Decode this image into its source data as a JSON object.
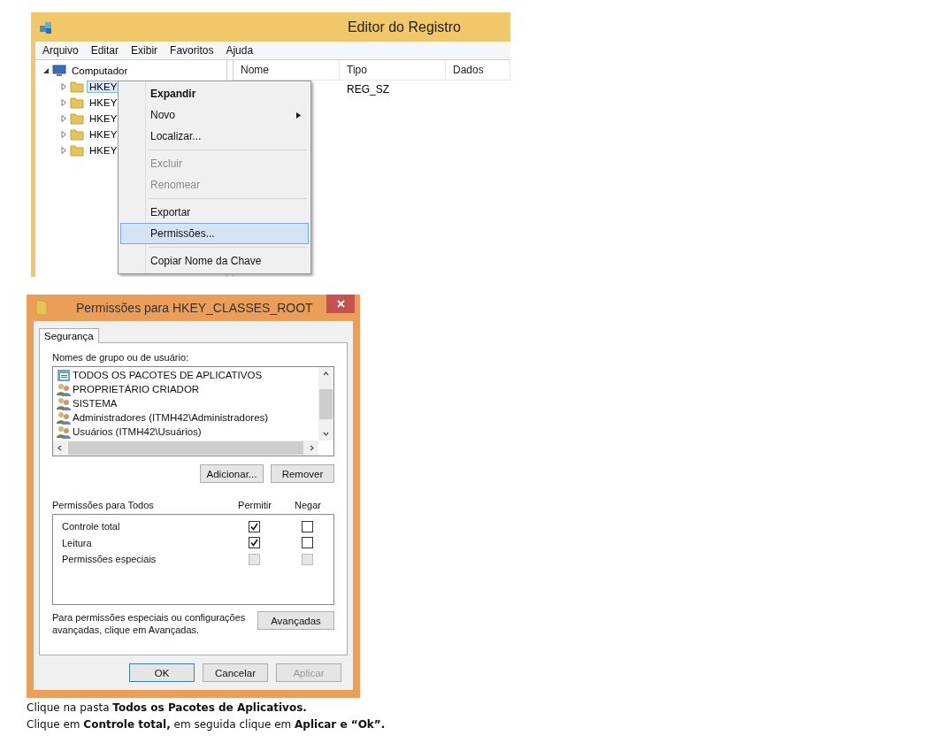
{
  "regedit": {
    "title": "Editor do Registro",
    "menu_bar": [
      "Arquivo",
      "Editar",
      "Exibir",
      "Favoritos",
      "Ajuda"
    ],
    "tree": [
      {
        "label": "Computador",
        "expanded": true,
        "selected": false,
        "children": [
          {
            "label": "HKEY",
            "expanded": false,
            "selected": true
          },
          {
            "label": "HKEY",
            "expanded": false,
            "selected": false
          },
          {
            "label": "HKEY",
            "expanded": false,
            "selected": false
          },
          {
            "label": "HKEY",
            "expanded": false,
            "selected": false
          },
          {
            "label": "HKEY",
            "expanded": false,
            "selected": false
          }
        ]
      }
    ],
    "columns": [
      "Nome",
      "Tipo",
      "Dados"
    ],
    "rows": [
      [
        "",
        "REG_SZ",
        ""
      ]
    ],
    "context_menu": [
      [
        {
          "label": "Expandir",
          "default": true,
          "disabled": false,
          "submenu": false,
          "selected": false
        },
        {
          "label": "Novo",
          "default": false,
          "disabled": false,
          "submenu": true,
          "selected": false
        },
        {
          "label": "Localizar...",
          "default": false,
          "disabled": false,
          "submenu": false,
          "selected": false
        }
      ],
      [
        {
          "label": "Excluir",
          "default": false,
          "disabled": true,
          "submenu": false,
          "selected": false
        },
        {
          "label": "Renomear",
          "default": false,
          "disabled": true,
          "submenu": false,
          "selected": false
        }
      ],
      [
        {
          "label": "Exportar",
          "default": false,
          "disabled": false,
          "submenu": false,
          "selected": false
        },
        {
          "label": "Permissões...",
          "default": false,
          "disabled": false,
          "submenu": false,
          "selected": true
        }
      ],
      [
        {
          "label": "Copiar Nome da Chave",
          "default": false,
          "disabled": false,
          "submenu": false,
          "selected": false
        }
      ]
    ]
  },
  "dialog": {
    "title": "Permissões para HKEY_CLASSES_ROOT",
    "tabs": [
      {
        "label": "Segurança",
        "selected": true
      }
    ],
    "users_label": "Nomes de grupo ou de usuário:",
    "users": [
      {
        "name": "TODOS OS PACOTES DE APLICATIVOS",
        "kind": "package"
      },
      {
        "name": "PROPRIETÁRIO CRIADOR",
        "kind": "group"
      },
      {
        "name": "SISTEMA",
        "kind": "group"
      },
      {
        "name": "Administradores (ITMH42\\Administradores)",
        "kind": "group"
      },
      {
        "name": "Usuários (ITMH42\\Usuários)",
        "kind": "group"
      }
    ],
    "user_buttons": [
      "Adicionar...",
      "Remover"
    ],
    "permissions_title": "Permissões para Todos",
    "permission_columns": [
      "Permitir",
      "Negar"
    ],
    "permissions": [
      {
        "name": "Controle total",
        "allow": {
          "checked": true,
          "disabled": false
        },
        "deny": {
          "checked": false,
          "disabled": false
        }
      },
      {
        "name": "Leitura",
        "allow": {
          "checked": true,
          "disabled": false
        },
        "deny": {
          "checked": false,
          "disabled": false
        }
      },
      {
        "name": "Permissões especiais",
        "allow": {
          "checked": false,
          "disabled": true
        },
        "deny": {
          "checked": false,
          "disabled": true
        }
      }
    ],
    "advanced_note": "Para permissões especiais ou configurações avançadas, clique em Avançadas.",
    "advanced_button": "Avançadas",
    "buttons": [
      {
        "label": "OK",
        "disabled": false,
        "default": true
      },
      {
        "label": "Cancelar",
        "disabled": false,
        "default": false
      },
      {
        "label": "Aplicar",
        "disabled": true,
        "default": false
      }
    ]
  },
  "instructions": [
    "Clique na pasta **Todos os Pacotes de Aplicativos.**",
    "Clique em **Controle total,** em seguida clique em **Aplicar e “Ok”.**"
  ]
}
